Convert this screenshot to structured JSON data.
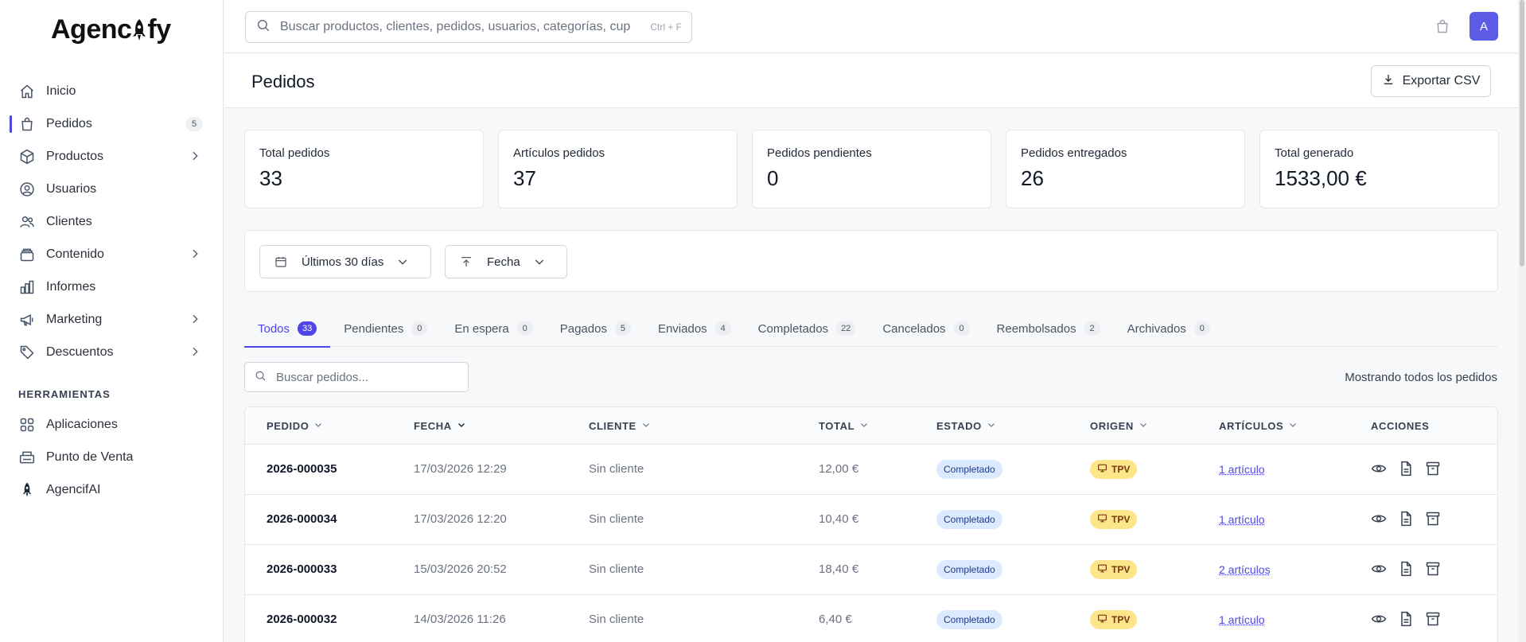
{
  "app": {
    "logo_left": "Agenc",
    "logo_right": "fy"
  },
  "sidebar": {
    "items": [
      {
        "label": "Inicio",
        "icon": "home-icon"
      },
      {
        "label": "Pedidos",
        "icon": "shopping-bag-icon",
        "count": "5",
        "active": true
      },
      {
        "label": "Productos",
        "icon": "box-icon",
        "expandable": true
      },
      {
        "label": "Usuarios",
        "icon": "user-circle-icon"
      },
      {
        "label": "Clientes",
        "icon": "users-icon"
      },
      {
        "label": "Contenido",
        "icon": "layers-icon",
        "expandable": true
      },
      {
        "label": "Informes",
        "icon": "bar-chart-icon"
      },
      {
        "label": "Marketing",
        "icon": "megaphone-icon",
        "expandable": true
      },
      {
        "label": "Descuentos",
        "icon": "tag-icon",
        "expandable": true
      }
    ],
    "tools_title": "HERRAMIENTAS",
    "tools": [
      {
        "label": "Aplicaciones",
        "icon": "grid-icon"
      },
      {
        "label": "Punto de Venta",
        "icon": "pos-icon"
      },
      {
        "label": "AgencifAI",
        "icon": "rocket-icon"
      }
    ]
  },
  "topbar": {
    "search_placeholder": "Buscar productos, clientes, pedidos, usuarios, categorías, cupones",
    "search_shortcut": "Ctrl + F",
    "avatar_initial": "A"
  },
  "page": {
    "title": "Pedidos",
    "export_label": "Exportar CSV"
  },
  "stats": [
    {
      "label": "Total pedidos",
      "value": "33"
    },
    {
      "label": "Artículos pedidos",
      "value": "37"
    },
    {
      "label": "Pedidos pendientes",
      "value": "0"
    },
    {
      "label": "Pedidos entregados",
      "value": "26"
    },
    {
      "label": "Total generado",
      "value": "1533,00 €"
    }
  ],
  "filters": {
    "date_range": "Últimos 30 días",
    "sort": "Fecha"
  },
  "tabs": [
    {
      "label": "Todos",
      "count": "33",
      "active": true
    },
    {
      "label": "Pendientes",
      "count": "0"
    },
    {
      "label": "En espera",
      "count": "0"
    },
    {
      "label": "Pagados",
      "count": "5"
    },
    {
      "label": "Enviados",
      "count": "4"
    },
    {
      "label": "Completados",
      "count": "22"
    },
    {
      "label": "Cancelados",
      "count": "0"
    },
    {
      "label": "Reembolsados",
      "count": "2"
    },
    {
      "label": "Archivados",
      "count": "0"
    }
  ],
  "orders_search": {
    "placeholder": "Buscar pedidos...",
    "showing": "Mostrando todos los pedidos"
  },
  "table": {
    "columns": {
      "order": "PEDIDO",
      "date": "FECHA",
      "customer": "CLIENTE",
      "total": "TOTAL",
      "status": "ESTADO",
      "origin": "ORIGEN",
      "items": "ARTÍCULOS",
      "actions": "ACCIONES"
    },
    "rows": [
      {
        "order": "2026-000035",
        "date": "17/03/2026 12:29",
        "customer": "Sin cliente",
        "total": "12,00 €",
        "status": "Completado",
        "origin": "TPV",
        "items": "1 artículo"
      },
      {
        "order": "2026-000034",
        "date": "17/03/2026 12:20",
        "customer": "Sin cliente",
        "total": "10,40 €",
        "status": "Completado",
        "origin": "TPV",
        "items": "1 artículo"
      },
      {
        "order": "2026-000033",
        "date": "15/03/2026 20:52",
        "customer": "Sin cliente",
        "total": "18,40 €",
        "status": "Completado",
        "origin": "TPV",
        "items": "2 artículos"
      },
      {
        "order": "2026-000032",
        "date": "14/03/2026 11:26",
        "customer": "Sin cliente",
        "total": "6,40 €",
        "status": "Completado",
        "origin": "TPV",
        "items": "1 artículo"
      }
    ]
  },
  "colors": {
    "accent": "#4f46e5",
    "status_completed_bg": "#dbeafe",
    "origin_tpv_bg": "#fde68a"
  }
}
